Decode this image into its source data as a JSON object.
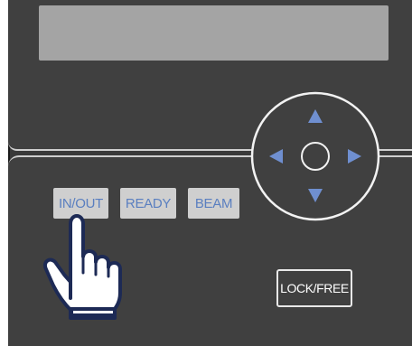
{
  "controls": {
    "in_out_label": "IN/OUT",
    "ready_label": "READY",
    "beam_label": "BEAM",
    "lock_free_label": "LOCK/FREE"
  },
  "colors": {
    "panel": "#404040",
    "key_face": "#cfcfcf",
    "key_text": "#5a7fc0",
    "arrow": "#6f8fd0",
    "display": "#a4a4a4"
  },
  "icons": {
    "dpad": "directional-pad",
    "pointer": "pointing-hand"
  }
}
